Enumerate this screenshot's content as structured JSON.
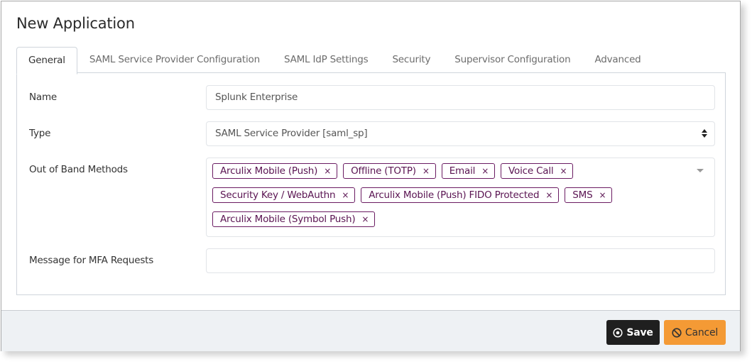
{
  "dialog": {
    "title": "New Application"
  },
  "tabs": [
    {
      "label": "General",
      "active": true
    },
    {
      "label": "SAML Service Provider Configuration",
      "active": false
    },
    {
      "label": "SAML IdP Settings",
      "active": false
    },
    {
      "label": "Security",
      "active": false
    },
    {
      "label": "Supervisor Configuration",
      "active": false
    },
    {
      "label": "Advanced",
      "active": false
    }
  ],
  "form": {
    "name": {
      "label": "Name",
      "value": "Splunk Enterprise"
    },
    "type": {
      "label": "Type",
      "value": "SAML Service Provider [saml_sp]"
    },
    "oob": {
      "label": "Out of Band Methods",
      "selected": [
        "Arculix Mobile (Push)",
        "Offline (TOTP)",
        "Email",
        "Voice Call",
        "Security Key / WebAuthn",
        "Arculix Mobile (Push) FIDO Protected",
        "SMS",
        "Arculix Mobile (Symbol Push)"
      ],
      "remove_glyph": "×"
    },
    "mfa_message": {
      "label": "Message for MFA Requests",
      "value": ""
    }
  },
  "footer": {
    "save_label": "Save",
    "cancel_label": "Cancel"
  },
  "colors": {
    "chip_border": "#6a1b62",
    "save_bg": "#1f1f1f",
    "cancel_bg": "#f49a35",
    "footer_bg": "#eef1f4"
  }
}
